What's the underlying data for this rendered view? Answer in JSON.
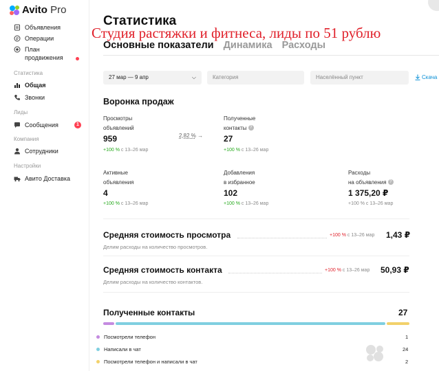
{
  "app": {
    "brand": "Avito",
    "brand_suffix": "Pro"
  },
  "sidebar": {
    "items_top": [
      {
        "label": "Объявления",
        "icon": "document-icon"
      },
      {
        "label": "Операции",
        "icon": "coin-icon"
      },
      {
        "label": "План продвижения",
        "label_l1": "План",
        "label_l2": "продвижения",
        "icon": "target-icon"
      }
    ],
    "group_stats": "Статистика",
    "stats_items": [
      {
        "label": "Общая",
        "icon": "bar-chart-icon",
        "active": true
      },
      {
        "label": "Звонки",
        "icon": "phone-icon"
      }
    ],
    "group_leads": "Лиды",
    "leads_items": [
      {
        "label": "Сообщения",
        "icon": "chat-icon",
        "badge": "1"
      }
    ],
    "group_company": "Компания",
    "company_items": [
      {
        "label": "Сотрудники",
        "icon": "person-icon"
      }
    ],
    "group_settings": "Настройки",
    "settings_items": [
      {
        "label": "Авито Доставка",
        "icon": "truck-icon"
      }
    ]
  },
  "page": {
    "title": "Статистика",
    "banner": "Студия растяжки и фитнеса, лиды по 51 рублю",
    "tabs": [
      "Основные показатели",
      "Динамика",
      "Расходы"
    ],
    "active_tab": "Основные показатели"
  },
  "filters": {
    "date": "27 мар — 9 апр",
    "category_placeholder": "Категория",
    "city_placeholder": "Населённый пункт",
    "download_label": "Скача"
  },
  "funnel": {
    "title": "Воронка продаж",
    "conversion": "2,82 %",
    "views": {
      "label_l1": "Просмотры",
      "label_l2": "объявлений",
      "value": "959",
      "delta_pct": "+100 %",
      "delta_ref": "с 13–26 мар"
    },
    "contacts": {
      "label_l1": "Полученные",
      "label_l2": "контакты",
      "value": "27",
      "delta_pct": "+100 %",
      "delta_ref": "с 13–26 мар"
    },
    "active_ads": {
      "label_l1": "Активные",
      "label_l2": "объявления",
      "value": "4",
      "delta_pct": "+100 %",
      "delta_ref": "с 13–26 мар"
    },
    "favorites": {
      "label_l1": "Добавления",
      "label_l2": "в избранное",
      "value": "102",
      "delta_pct": "+100 %",
      "delta_ref": "с 13–26 мар"
    },
    "spend": {
      "label_l1": "Расходы",
      "label_l2": "на объявления",
      "value": "1 375,20 ₽",
      "delta_pct": "+100 %",
      "delta_ref": "с 13–26 мар"
    }
  },
  "costs": {
    "per_view": {
      "title": "Средняя стоимость просмотра",
      "delta_pct": "+100 %",
      "delta_ref": "с 13–26 мар",
      "value": "1,43 ₽",
      "desc": "Делим расходы на количество просмотров."
    },
    "per_contact": {
      "title": "Средняя стоимость контакта",
      "delta_pct": "+100 %",
      "delta_ref": "с 13–26 мар",
      "value": "50,93 ₽",
      "desc": "Делим расходы на количество контактов."
    }
  },
  "contacts_breakdown": {
    "title": "Полученные контакты",
    "total": "27",
    "items": [
      {
        "label": "Посмотрели телефон",
        "count": "1",
        "color": "#c48be0"
      },
      {
        "label": "Написали в чат",
        "count": "24",
        "color": "#7fcfe0"
      },
      {
        "label": "Посмотрели телефон и написали в чат",
        "count": "2",
        "color": "#f2d16b"
      }
    ]
  },
  "colors": {
    "accent": "#0a8fd6",
    "positive": "#23a81a",
    "negative": "#e0202a",
    "banner": "#e0202a"
  }
}
